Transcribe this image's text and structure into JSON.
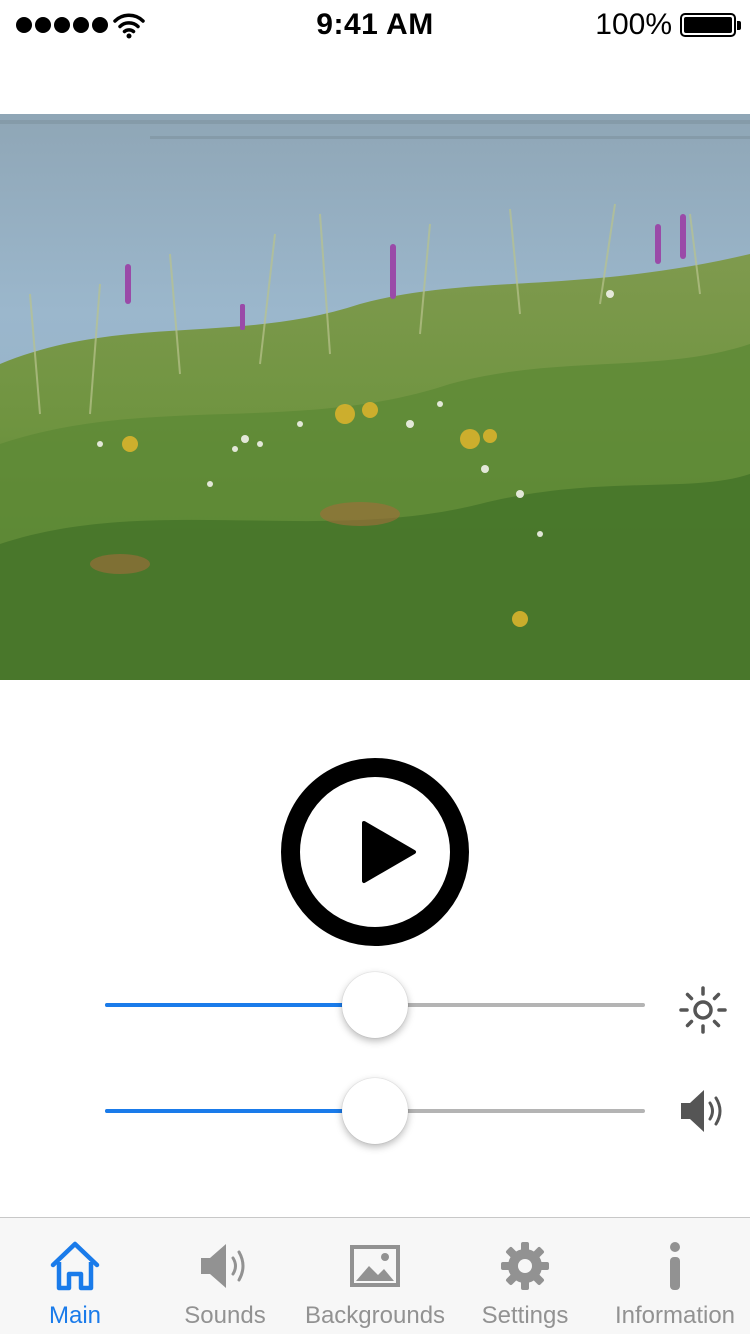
{
  "status_bar": {
    "time": "9:41 AM",
    "battery": "100%",
    "signal_bars": 5
  },
  "background_image": {
    "icon": "lake-meadow-photo"
  },
  "player": {
    "play_icon": "play-icon",
    "brightness": {
      "value": 0.5,
      "icon": "sun-icon"
    },
    "volume": {
      "value": 0.5,
      "icon": "speaker-icon"
    }
  },
  "tab_bar": {
    "active": "Main",
    "tabs": [
      {
        "label": "Main",
        "icon": "home-icon"
      },
      {
        "label": "Sounds",
        "icon": "speaker-icon"
      },
      {
        "label": "Backgrounds",
        "icon": "image-icon"
      },
      {
        "label": "Settings",
        "icon": "gear-icon"
      },
      {
        "label": "Information",
        "icon": "info-icon"
      }
    ]
  },
  "colors": {
    "accent": "#1a7bea",
    "inactive": "#929292",
    "track": "#b4b4b4"
  }
}
